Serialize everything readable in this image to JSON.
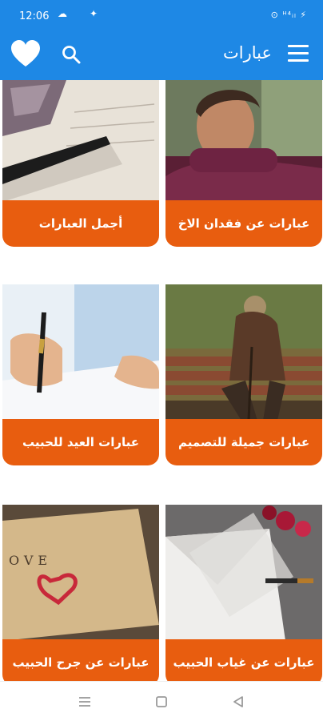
{
  "status_bar": {
    "time": "12:06",
    "right_indicators": "⊙ ᴴ⁴ᵢₗ ⚡"
  },
  "app_bar": {
    "title": "عبارات",
    "favorite_icon": "heart-icon",
    "search_icon": "search-icon",
    "menu_icon": "menu-icon"
  },
  "categories": [
    {
      "label": "عبارات عن فقدان الاخ"
    },
    {
      "label": "أجمل العبارات"
    },
    {
      "label": "عبارات جميلة للتصميم"
    },
    {
      "label": "عبارات العيد للحبيب"
    },
    {
      "label": "عبارات عن غياب الحبيب"
    },
    {
      "label": "عبارات عن جرح الحبيب"
    }
  ],
  "colors": {
    "primary": "#1e88e5",
    "card_label": "#e85d0f"
  },
  "nav_bar": {
    "recents_icon": "recents-icon",
    "home_icon": "home-icon",
    "back_icon": "back-icon"
  }
}
